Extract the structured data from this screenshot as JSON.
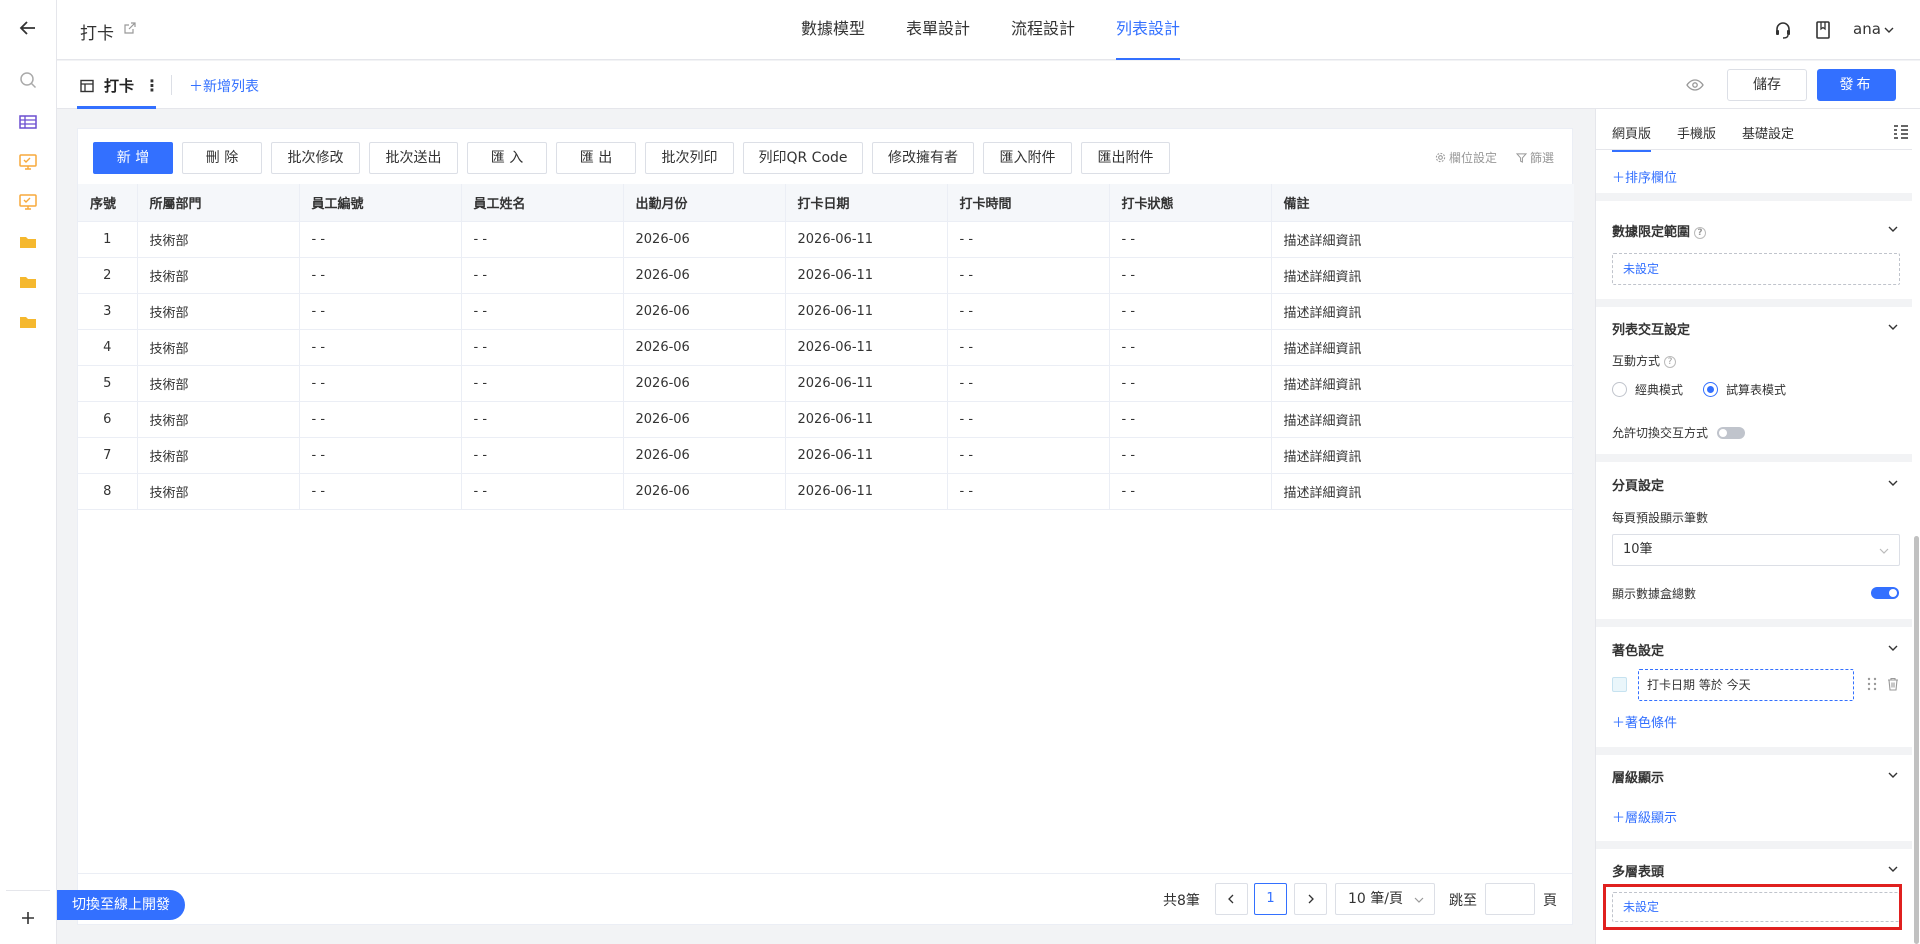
{
  "app": {
    "title": "打卡"
  },
  "header": {
    "tabs": [
      {
        "label": "數據模型",
        "active": false
      },
      {
        "label": "表單設計",
        "active": false
      },
      {
        "label": "流程設計",
        "active": false
      },
      {
        "label": "列表設計",
        "active": true
      }
    ],
    "user": "ana"
  },
  "subbar": {
    "list_tab": "打卡",
    "add_list": "＋新增列表",
    "save": "儲存",
    "publish": "發布"
  },
  "toolbar": {
    "buttons": [
      "新 增",
      "刪 除",
      "批次修改",
      "批次送出",
      "匯 入",
      "匯 出",
      "批次列印",
      "列印QR Code",
      "修改擁有者",
      "匯入附件",
      "匯出附件"
    ],
    "field_settings": "欄位設定",
    "filter": "篩選"
  },
  "table": {
    "columns": [
      "序號",
      "所屬部門",
      "員工編號",
      "員工姓名",
      "出勤月份",
      "打卡日期",
      "打卡時間",
      "打卡狀態",
      "備註"
    ],
    "rows": [
      [
        "1",
        "技術部",
        "- -",
        "- -",
        "2026-06",
        "2026-06-11",
        "- -",
        "- -",
        "描述詳細資訊"
      ],
      [
        "2",
        "技術部",
        "- -",
        "- -",
        "2026-06",
        "2026-06-11",
        "- -",
        "- -",
        "描述詳細資訊"
      ],
      [
        "3",
        "技術部",
        "- -",
        "- -",
        "2026-06",
        "2026-06-11",
        "- -",
        "- -",
        "描述詳細資訊"
      ],
      [
        "4",
        "技術部",
        "- -",
        "- -",
        "2026-06",
        "2026-06-11",
        "- -",
        "- -",
        "描述詳細資訊"
      ],
      [
        "5",
        "技術部",
        "- -",
        "- -",
        "2026-06",
        "2026-06-11",
        "- -",
        "- -",
        "描述詳細資訊"
      ],
      [
        "6",
        "技術部",
        "- -",
        "- -",
        "2026-06",
        "2026-06-11",
        "- -",
        "- -",
        "描述詳細資訊"
      ],
      [
        "7",
        "技術部",
        "- -",
        "- -",
        "2026-06",
        "2026-06-11",
        "- -",
        "- -",
        "描述詳細資訊"
      ],
      [
        "8",
        "技術部",
        "- -",
        "- -",
        "2026-06",
        "2026-06-11",
        "- -",
        "- -",
        "描述詳細資訊"
      ]
    ]
  },
  "pagination": {
    "total": "共8筆",
    "current_page": "1",
    "page_size": "10 筆/頁",
    "goto": "跳至",
    "page_suffix": "頁"
  },
  "switch_online": "切換至線上開發",
  "panel": {
    "tabs": [
      {
        "label": "網頁版",
        "active": true
      },
      {
        "label": "手機版",
        "active": false
      },
      {
        "label": "基礎設定",
        "active": false
      }
    ],
    "sort_fields": "＋排序欄位",
    "data_scope": {
      "title": "數據限定範圍",
      "value": "未設定"
    },
    "interaction": {
      "title": "列表交互設定",
      "mode_label": "互動方式",
      "options": [
        "經典模式",
        "試算表模式"
      ],
      "selected": "試算表模式",
      "allow_switch_label": "允許切換交互方式",
      "allow_switch": false
    },
    "pagination": {
      "title": "分頁設定",
      "per_page_label": "每頁預設顯示筆數",
      "per_page_value": "10筆",
      "show_total_label": "顯示數據盒總數",
      "show_total": true
    },
    "coloring": {
      "title": "著色設定",
      "condition": "打卡日期 等於 今天",
      "add": "＋著色條件"
    },
    "hierarchy": {
      "title": "層級顯示",
      "add": "＋層級顯示"
    },
    "multi_header": {
      "title": "多層表頭",
      "value": "未設定"
    }
  },
  "colors": {
    "accent": "#3370ff",
    "highlight": "#e0201f",
    "folder": "#f5b82e",
    "monitor": "#f7a93b"
  }
}
